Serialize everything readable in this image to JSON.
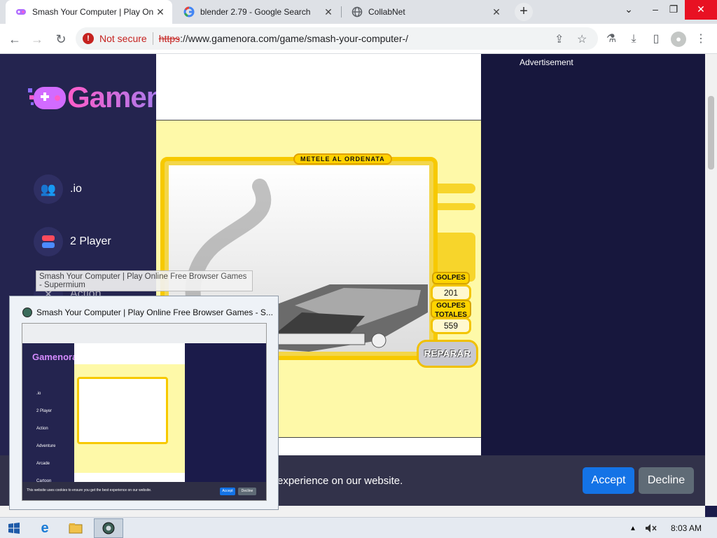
{
  "tabs": [
    {
      "title": "Smash Your Computer | Play Onl",
      "favicon": "gamenora-controller-icon",
      "active": true
    },
    {
      "title": "blender 2.79 - Google Search",
      "favicon": "google-g-icon",
      "active": false
    },
    {
      "title": "CollabNet",
      "favicon": "globe-icon",
      "active": false
    }
  ],
  "address_bar": {
    "security_label": "Not secure",
    "url_scheme": "https",
    "url_rest": "://www.gamenora.com/game/smash-your-computer-/"
  },
  "sidebar": {
    "logo_text": "Gamenora",
    "categories": [
      {
        "label": ".io",
        "icon": "people-icon"
      },
      {
        "label": "2 Player",
        "icon": "two-player-icon"
      },
      {
        "label": "Action",
        "icon": "action-icon"
      }
    ]
  },
  "game": {
    "title": "METELE AL ORDENATA",
    "golpes_label": "GOLPES",
    "golpes_value": "201",
    "golpes_totales_label_1": "GOLPES",
    "golpes_totales_label_2": "TOTALES",
    "golpes_totales_value": "559",
    "repair_label": "REPARAR"
  },
  "ad_label": "Advertisement",
  "cookie": {
    "text": "experience on our website.",
    "accept": "Accept",
    "decline": "Decline",
    "mini_text": "This website uses cookies to ensure you get the best experience on our website."
  },
  "tooltip": "Smash Your Computer | Play Online Free Browser Games - Supermium",
  "preview": {
    "title": "Smash Your Computer | Play Online Free Browser Games - S...",
    "mini_categories": [
      ".io",
      "2 Player",
      "Action",
      "Adventure",
      "Arcade",
      "Cartoon"
    ]
  },
  "taskbar": {
    "clock": "8:03 AM"
  },
  "colors": {
    "page_bg": "#17173d",
    "sidebar_bg": "#24244f",
    "game_bg": "#fef9a8",
    "accent_yellow": "#f7c900",
    "accept_blue": "#1473e6"
  }
}
